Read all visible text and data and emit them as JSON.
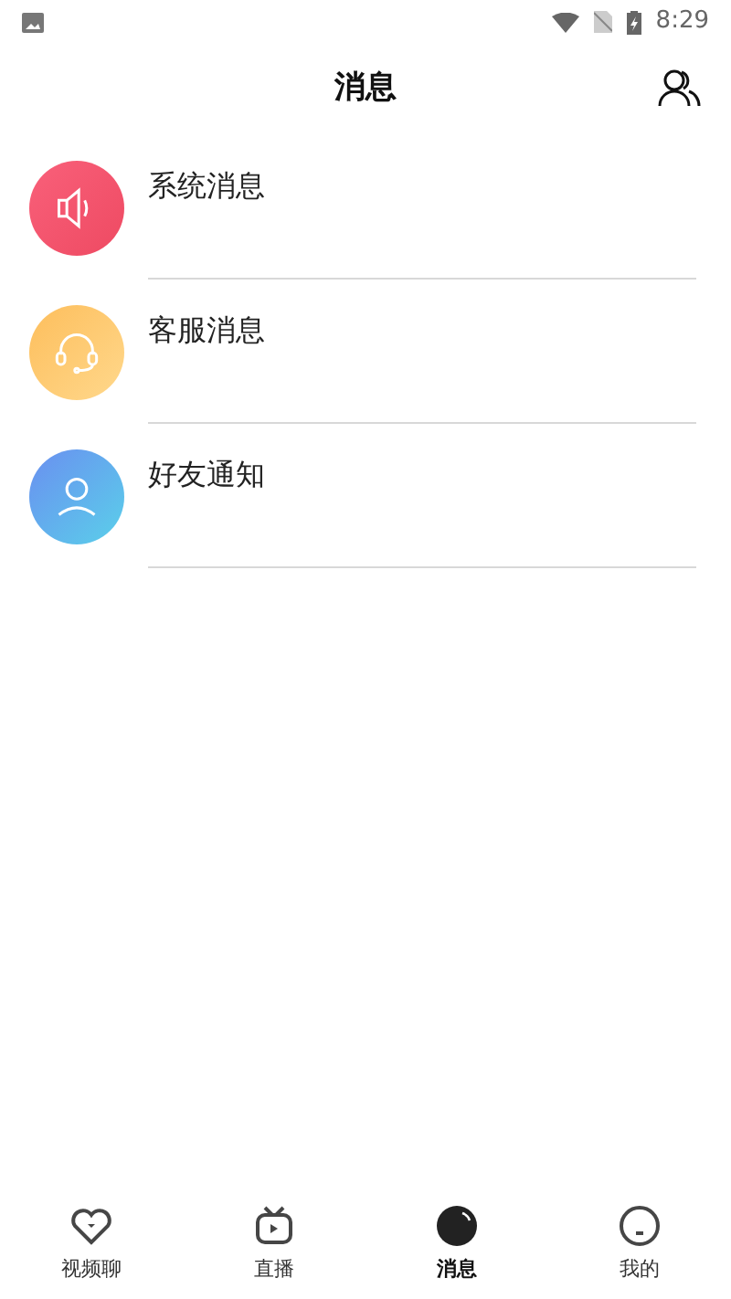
{
  "status_bar": {
    "time": "8:29"
  },
  "header": {
    "title": "消息"
  },
  "items": [
    {
      "kind": "system",
      "label": "系统消息"
    },
    {
      "kind": "service",
      "label": "客服消息"
    },
    {
      "kind": "friend",
      "label": "好友通知"
    }
  ],
  "tabs": [
    {
      "kind": "video",
      "label": "视频聊",
      "selected": false
    },
    {
      "kind": "live",
      "label": "直播",
      "selected": false
    },
    {
      "kind": "message",
      "label": "消息",
      "selected": true
    },
    {
      "kind": "mine",
      "label": "我的",
      "selected": false
    }
  ]
}
